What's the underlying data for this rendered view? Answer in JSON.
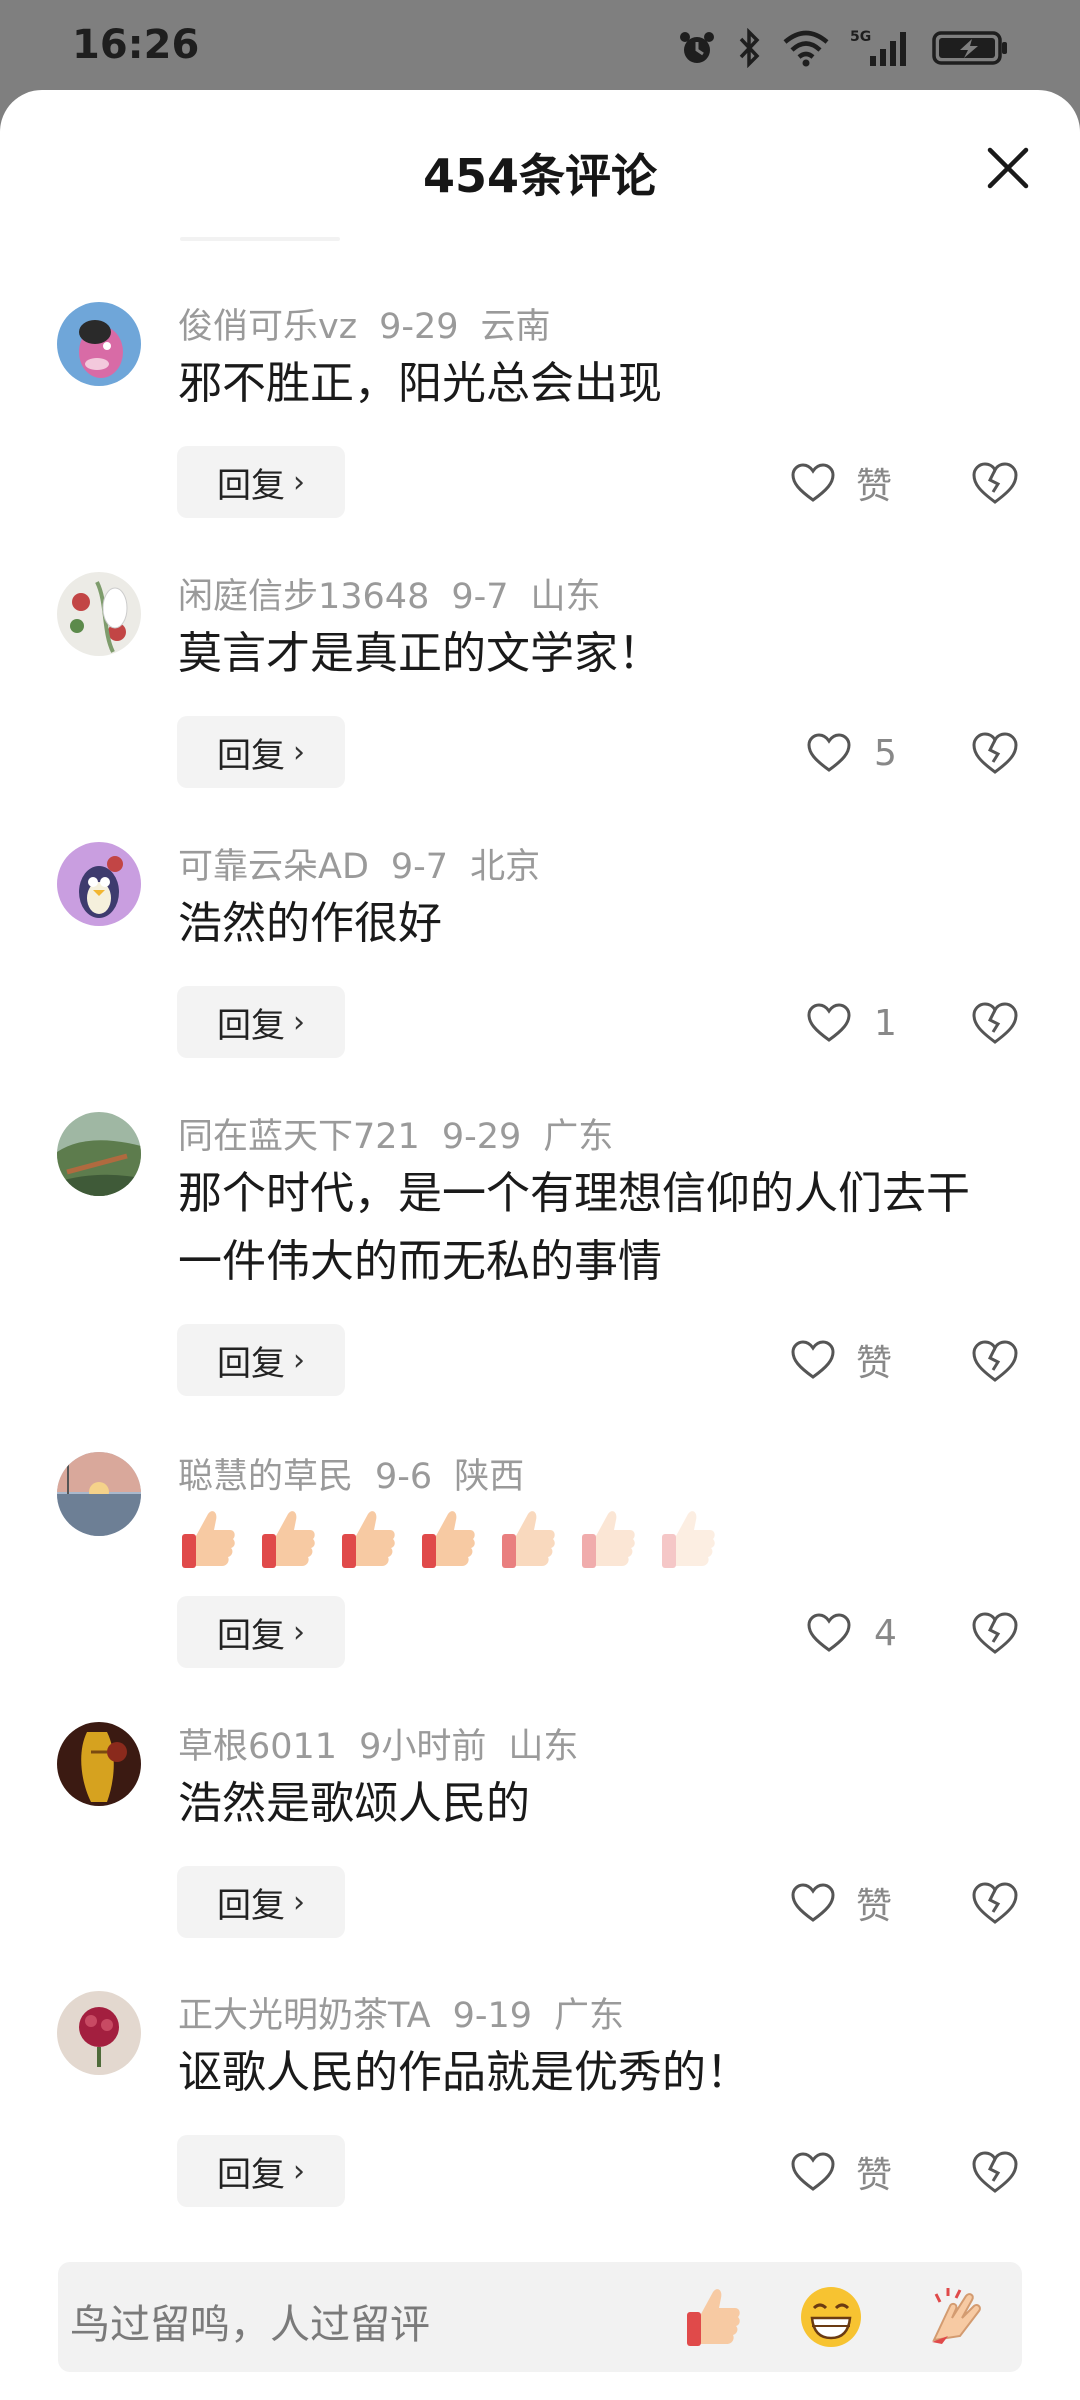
{
  "status": {
    "time": "16:26",
    "icons": [
      "alarm-icon",
      "bluetooth-icon",
      "wifi-icon",
      "signal-5g-icon",
      "battery-charging-icon"
    ],
    "network": "5G"
  },
  "sheet": {
    "title": "454条评论",
    "close_icon": "close-icon"
  },
  "comments": [
    {
      "user": "俊俏可乐vz",
      "date": "9-29",
      "location": "云南",
      "text": "邪不胜正，阳光总会出现",
      "reply": "回复",
      "likes": "赞",
      "avatar": "cartoon-avatar-blue"
    },
    {
      "user": "闲庭信步13648",
      "date": "9-7",
      "location": "山东",
      "text": "莫言才是真正的文学家！",
      "reply": "回复",
      "likes": "5",
      "avatar": "floral-avatar"
    },
    {
      "user": "可靠云朵AD",
      "date": "9-7",
      "location": "北京",
      "text": "浩然的作很好",
      "reply": "回复",
      "likes": "1",
      "avatar": "penguin-avatar-purple"
    },
    {
      "user": "同在蓝天下721",
      "date": "9-29",
      "location": "广东",
      "text": "那个时代，是一个有理想信仰的人们去干一件伟大的而无私的事情",
      "reply": "回复",
      "likes": "赞",
      "avatar": "landscape-avatar"
    },
    {
      "user": "聪慧的草民",
      "date": "9-6",
      "location": "陕西",
      "text": "",
      "reply": "回复",
      "likes": "4",
      "avatar": "sunset-avatar",
      "emoji": [
        "thumbs-up-icon",
        "thumbs-up-icon",
        "thumbs-up-icon",
        "thumbs-up-icon",
        "thumbs-up-icon",
        "thumbs-up-icon",
        "thumbs-up-icon"
      ]
    },
    {
      "user": "草根6011",
      "date": "9小时前",
      "location": "山东",
      "text": "浩然是歌颂人民的",
      "reply": "回复",
      "likes": "赞",
      "avatar": "dark-avatar"
    },
    {
      "user": "正大光明奶茶TA",
      "date": "9-19",
      "location": "广东",
      "text": "讴歌人民的作品就是优秀的！",
      "reply": "回复",
      "likes": "赞",
      "avatar": "flower-avatar-red"
    }
  ],
  "input": {
    "placeholder": "鸟过留鸣，人过留评",
    "quick_emojis": [
      "thumbs-up-icon",
      "grin-icon",
      "clap-icon"
    ]
  },
  "colors": {
    "background_overlay": "#7f7f7f",
    "sheet": "#ffffff",
    "meta_text": "#9a9a9a",
    "reply_bg": "#f3f3f3",
    "input_bg": "#f2f2f2"
  }
}
